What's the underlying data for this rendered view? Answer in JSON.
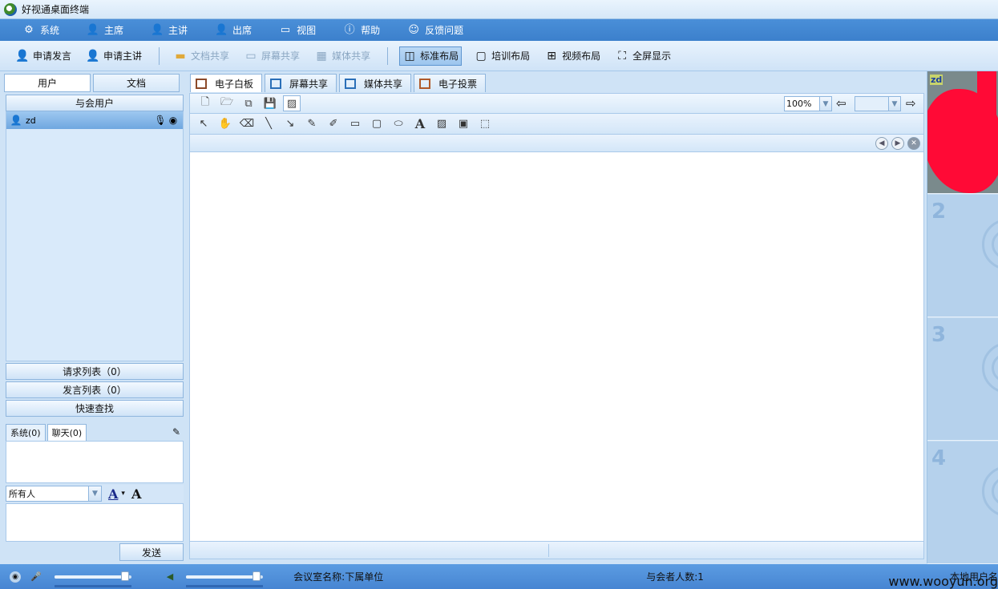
{
  "app": {
    "title": "好视通桌面终端"
  },
  "menu": [
    {
      "label": "系统",
      "icon": "gear-icon",
      "glyph": "⚙"
    },
    {
      "label": "主席",
      "icon": "chair-user-icon",
      "glyph": "👤"
    },
    {
      "label": "主讲",
      "icon": "speaker-user-icon",
      "glyph": "👤"
    },
    {
      "label": "出席",
      "icon": "attend-user-icon",
      "glyph": "👤"
    },
    {
      "label": "视图",
      "icon": "monitor-icon",
      "glyph": "🖵"
    },
    {
      "label": "帮助",
      "icon": "info-icon",
      "glyph": "ⓘ"
    },
    {
      "label": "反馈问题",
      "icon": "feedback-icon",
      "glyph": "☺"
    }
  ],
  "toolbar": {
    "request_speak": "申请发言",
    "request_present": "申请主讲",
    "doc_share": "文档共享",
    "screen_share": "屏幕共享",
    "media_share": "媒体共享",
    "standard_layout": "标准布局",
    "training_layout": "培训布局",
    "video_layout": "视频布局",
    "fullscreen": "全屏显示"
  },
  "left": {
    "tabs": [
      "用户",
      "文档"
    ],
    "attendees_button": "与会用户",
    "users": [
      {
        "name": "zd"
      }
    ],
    "request_list": "请求列表（0）",
    "speak_list": "发言列表（0）",
    "quick_search": "快速查找"
  },
  "chat": {
    "tabs": [
      "系统(0)",
      "聊天(0)"
    ],
    "recipient": "所有人",
    "font_color_glyph": "A",
    "font_glyph": "A",
    "send": "发送"
  },
  "center": {
    "tabs": [
      "电子白板",
      "屏幕共享",
      "媒体共享",
      "电子投票"
    ],
    "tab_colors": [
      "#8b4a2a",
      "#2a6fb8",
      "#2a6fb8",
      "#b05a2a"
    ],
    "zoom": "100%"
  },
  "video_slots": [
    {
      "label": "zd"
    },
    {
      "number": "2"
    },
    {
      "number": "3"
    },
    {
      "number": "4"
    }
  ],
  "status": {
    "room_name": "会议室名称:下属单位",
    "attendee_count": "与会者人数:1",
    "local_user_prefix": "本地用户名",
    "mic_level": 1.0,
    "speaker_level": 1.0
  },
  "watermark": "www.wooyun.org"
}
